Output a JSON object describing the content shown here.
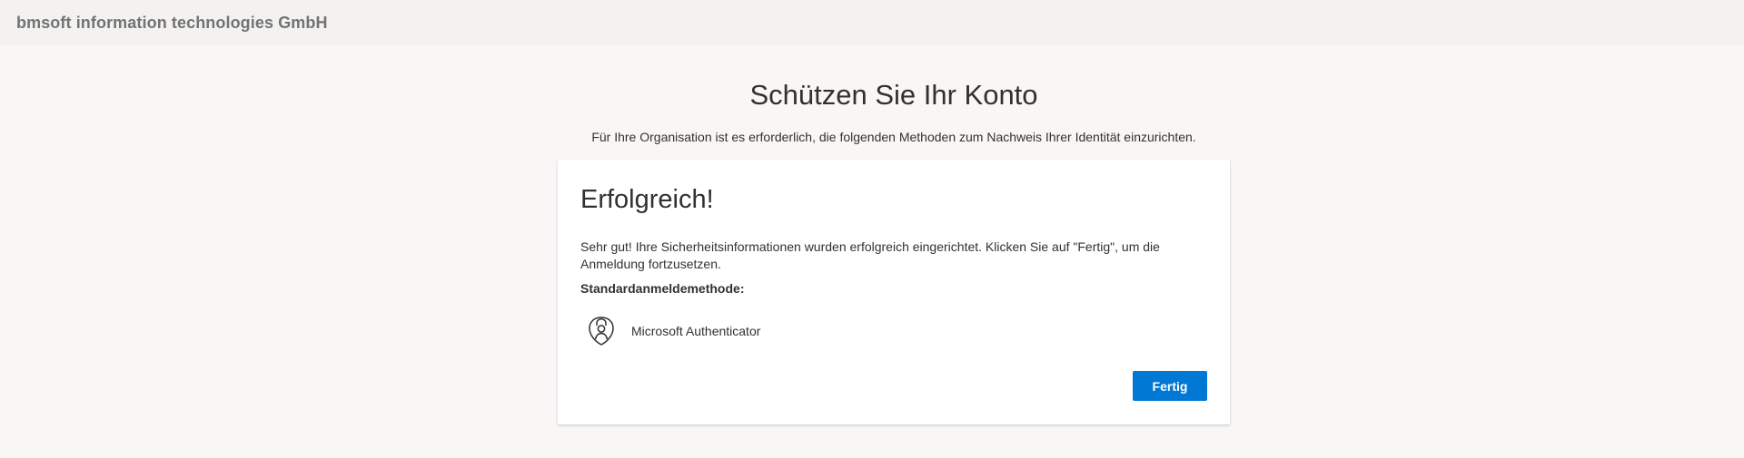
{
  "header": {
    "org_name": "bmsoft information technologies GmbH"
  },
  "main": {
    "title": "Schützen Sie Ihr Konto",
    "subtitle": "Für Ihre Organisation ist es erforderlich, die folgenden Methoden zum Nachweis Ihrer Identität einzurichten."
  },
  "card": {
    "title": "Erfolgreich!",
    "message": "Sehr gut! Ihre Sicherheitsinformationen wurden erfolgreich eingerichtet. Klicken Sie auf \"Fertig\", um die Anmeldung fortzusetzen.",
    "default_method_label": "Standardanmeldemethode:",
    "method": {
      "icon": "authenticator-lock-icon",
      "name": "Microsoft Authenticator"
    },
    "done_label": "Fertig"
  },
  "colors": {
    "accent": "#0078d4",
    "background": "#f8f7f6",
    "header_background": "#f3f2f1"
  }
}
